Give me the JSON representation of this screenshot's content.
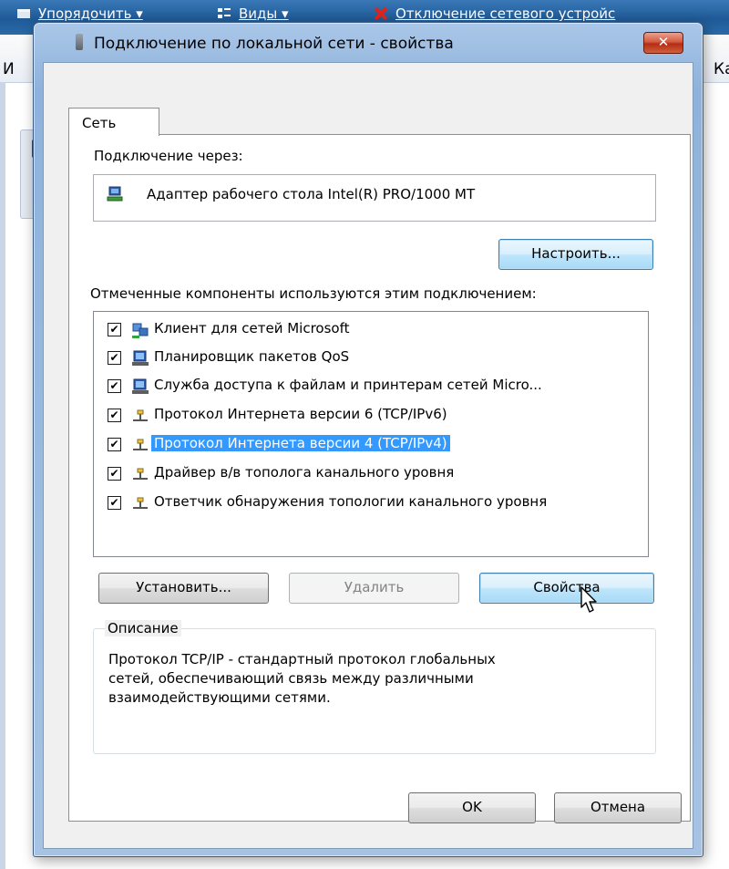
{
  "background_window": {
    "toolbar_items": [
      {
        "label": "Упорядочить",
        "icon": "organize-icon"
      },
      {
        "label": "Виды",
        "icon": "views-icon"
      },
      {
        "label": "Отключение сетевого устройс",
        "icon": "disconnect-icon"
      }
    ],
    "left_header_text": "И",
    "right_header_text": "Ка",
    "left_small_text": "Л"
  },
  "dialog": {
    "title": "Подключение по локальной сети - свойства",
    "close_label": "✕",
    "tabs": [
      {
        "label": "Сеть"
      }
    ],
    "connect_using_label": "Подключение через:",
    "adapter_name": "Адаптер рабочего стола Intel(R) PRO/1000 MT",
    "configure_button": "Настроить...",
    "components_label": "Отмеченные компоненты используются этим подключением:",
    "components": [
      {
        "label": "Клиент для сетей Microsoft",
        "checked": true,
        "icon": "network-client-icon",
        "selected": false
      },
      {
        "label": "Планировщик пакетов QoS",
        "checked": true,
        "icon": "network-service-icon",
        "selected": false
      },
      {
        "label": "Служба доступа к файлам и принтерам сетей Micro...",
        "checked": true,
        "icon": "network-service-icon",
        "selected": false
      },
      {
        "label": "Протокол Интернета версии 6 (TCP/IPv6)",
        "checked": true,
        "icon": "protocol-icon",
        "selected": false
      },
      {
        "label": "Протокол Интернета версии 4 (TCP/IPv4)",
        "checked": true,
        "icon": "protocol-icon",
        "selected": true
      },
      {
        "label": "Драйвер в/в тополога канального уровня",
        "checked": true,
        "icon": "protocol-icon",
        "selected": false
      },
      {
        "label": "Ответчик обнаружения топологии канального уровня",
        "checked": true,
        "icon": "protocol-icon",
        "selected": false
      }
    ],
    "install_button": "Установить...",
    "uninstall_button": "Удалить",
    "properties_button": "Свойства",
    "description_group_label": "Описание",
    "description_text": "Протокол TCP/IP - стандартный протокол глобальных\nсетей, обеспечивающий связь между различными\nвзаимодействующими сетями.",
    "ok_button": "OK",
    "cancel_button": "Отмена"
  },
  "colors": {
    "selection": "#3399ff",
    "title_bar": "#a6c3e4",
    "close_button": "#c8482b"
  }
}
